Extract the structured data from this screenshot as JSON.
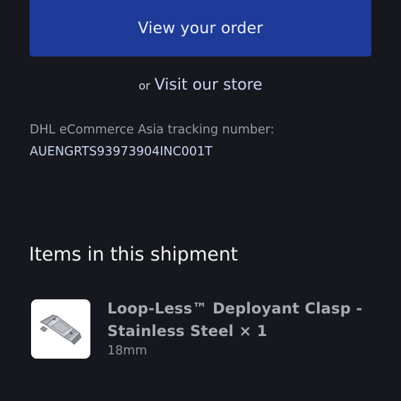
{
  "order": {
    "view_order_label": "View your order",
    "or_text": "or",
    "visit_store_label": "Visit our store"
  },
  "tracking": {
    "label": "DHL eCommerce Asia tracking number:",
    "number": "AUENGRTS93973904INC001T"
  },
  "shipment": {
    "title": "Items in this shipment",
    "items": [
      {
        "name": "Loop-Less™ Deployant Clasp - Stainless Steel × 1",
        "variant": "18mm",
        "thumbnail_icon": "deployant-clasp-image"
      }
    ]
  },
  "colors": {
    "background": "#16181d",
    "button": "#1f3b99",
    "link": "#c9d3f3"
  }
}
